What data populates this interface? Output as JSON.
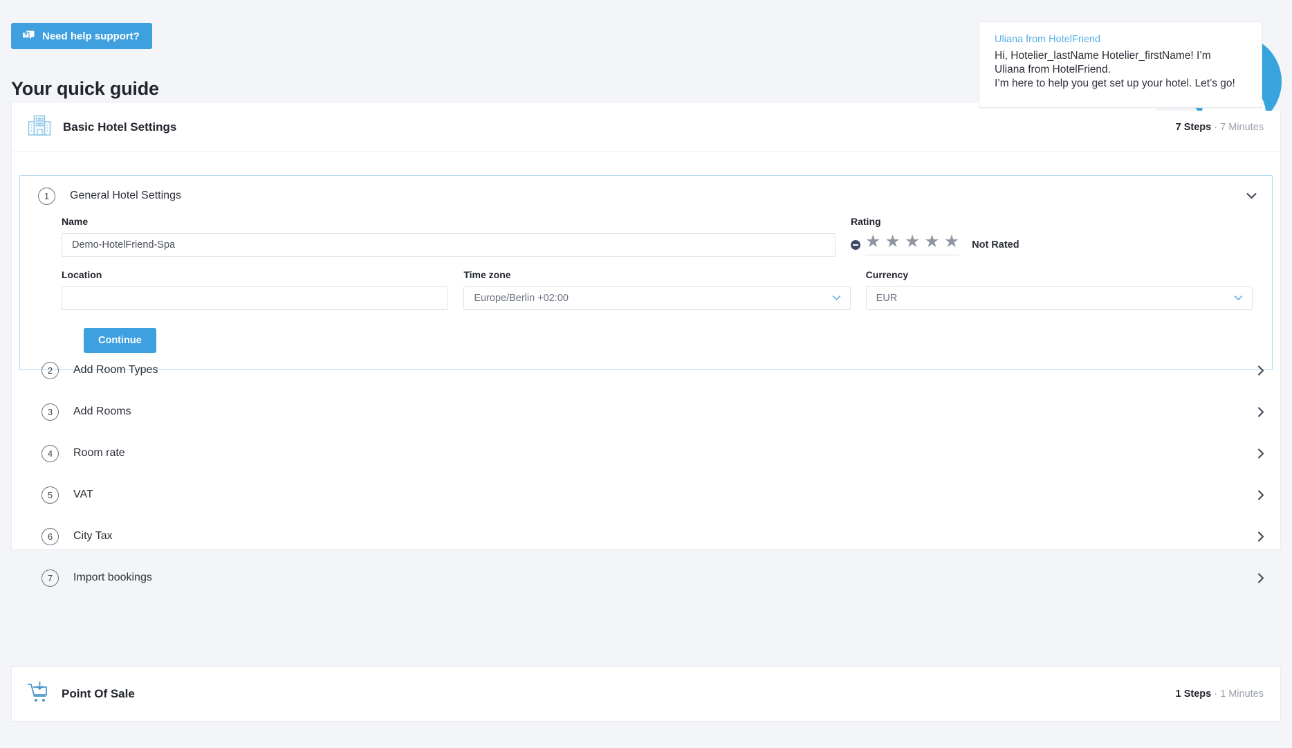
{
  "topbar": {
    "help_button": "Need help support?",
    "help_icon": "chat-question-icon"
  },
  "page_title": "Your quick guide",
  "chat": {
    "sender": "Uliana from HotelFriend",
    "line1": "Hi, Hotelier_lastName Hotelier_firstName! I’m",
    "line2": "Uliana from HotelFriend.",
    "line3": "I’m here to help you get set up your hotel. Let’s go!",
    "avatar_name": "uliana-avatar-photo"
  },
  "colors": {
    "accent": "#3fa0e0",
    "icon_blue": "#8fc6e8",
    "active_border": "#aed7f0",
    "page_bg": "#f4f5f9",
    "text_dark": "#21252c",
    "text_muted": "#9aa0ac"
  },
  "sections": [
    {
      "icon": "hotel-building-icon",
      "title": "Basic Hotel Settings",
      "steps_count": "7 Steps",
      "separator": "·",
      "duration": "7 Minutes"
    },
    {
      "icon": "point-of-sale-cart-icon",
      "title": "Point Of Sale",
      "steps_count": "1 Steps",
      "separator": "·",
      "duration": "1 Minutes"
    }
  ],
  "active_step": {
    "number": "1",
    "label": "General Hotel Settings",
    "collapse_icon": "chevron-down-icon",
    "fields": {
      "name": {
        "label": "Name",
        "value": "Demo-HotelFriend-Spa"
      },
      "rating": {
        "label": "Rating",
        "status": "Not Rated",
        "stars": [
          "★",
          "★",
          "★",
          "★",
          "★"
        ],
        "clear_icon": "minus-circle-icon"
      },
      "location": {
        "label": "Location",
        "value": ""
      },
      "timezone": {
        "label": "Time zone",
        "value": "Europe/Berlin +02:00",
        "icon": "chevron-down-icon"
      },
      "currency": {
        "label": "Currency",
        "value": "EUR",
        "icon": "chevron-down-icon"
      }
    },
    "continue_button": "Continue"
  },
  "steps": [
    {
      "number": "2",
      "label": "Add Room Types",
      "icon": "chevron-right-icon"
    },
    {
      "number": "3",
      "label": "Add Rooms",
      "icon": "chevron-right-icon"
    },
    {
      "number": "4",
      "label": "Room rate",
      "icon": "chevron-right-icon"
    },
    {
      "number": "5",
      "label": "VAT",
      "icon": "chevron-right-icon"
    },
    {
      "number": "6",
      "label": "City Tax",
      "icon": "chevron-right-icon"
    },
    {
      "number": "7",
      "label": "Import bookings",
      "icon": "chevron-right-icon"
    }
  ]
}
